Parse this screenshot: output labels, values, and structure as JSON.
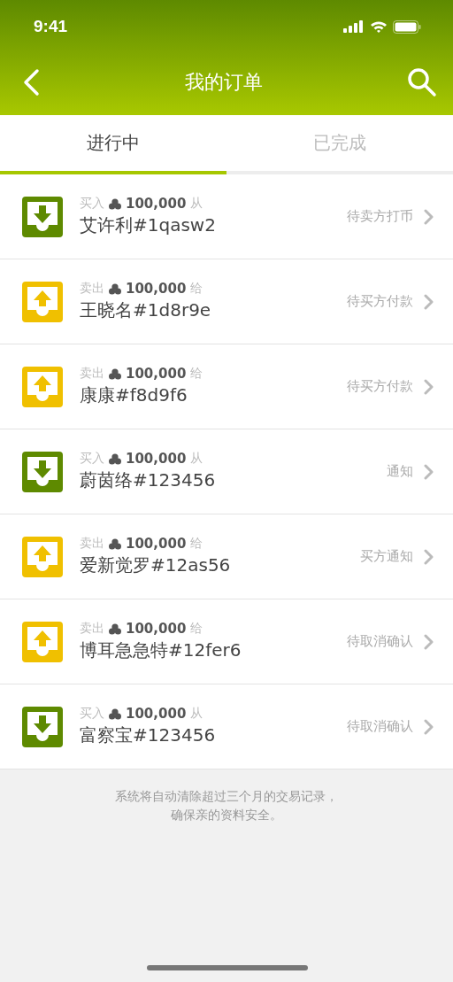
{
  "status_bar": {
    "time": "9:41"
  },
  "nav": {
    "title": "我的订单"
  },
  "tabs": [
    {
      "label": "进行中",
      "selected": true
    },
    {
      "label": "已完成",
      "selected": false
    }
  ],
  "orders": [
    {
      "kind": "buy",
      "action": "买入",
      "amount": "100,000",
      "preposition": "从",
      "party": "艾许利#1qasw2",
      "status": "待卖方打币"
    },
    {
      "kind": "sell",
      "action": "卖出",
      "amount": "100,000",
      "preposition": "给",
      "party": "王晓名#1d8r9e",
      "status": "待买方付款"
    },
    {
      "kind": "sell",
      "action": "卖出",
      "amount": "100,000",
      "preposition": "给",
      "party": "康康#f8d9f6",
      "status": "待买方付款"
    },
    {
      "kind": "buy",
      "action": "买入",
      "amount": "100,000",
      "preposition": "从",
      "party": "蔚茵络#123456",
      "status": "通知"
    },
    {
      "kind": "sell",
      "action": "卖出",
      "amount": "100,000",
      "preposition": "给",
      "party": "爱新觉罗#12as56",
      "status": "买方通知"
    },
    {
      "kind": "sell",
      "action": "卖出",
      "amount": "100,000",
      "preposition": "给",
      "party": "博耳急急特#12fer6",
      "status": "待取消确认"
    },
    {
      "kind": "buy",
      "action": "买入",
      "amount": "100,000",
      "preposition": "从",
      "party": "富察宝#123456",
      "status": "待取消确认"
    }
  ],
  "notice": [
    "系统将自动清除超过三个月的交易记录，",
    "确保亲的资料安全。"
  ]
}
